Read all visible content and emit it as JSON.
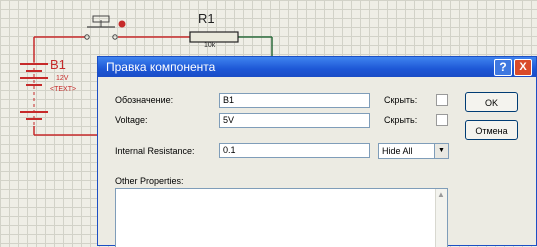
{
  "schematic": {
    "battery_label": "B1",
    "battery_voltage": "12V",
    "battery_text": "<TEXT>",
    "resistor_label": "R1",
    "resistor_value": "10k"
  },
  "dialog": {
    "title": "Правка компонента",
    "help_label": "?",
    "close_label": "X",
    "designator_label": "Обозначение:",
    "designator_value": "B1",
    "hide_label_1": "Скрыть:",
    "voltage_label": "Voltage:",
    "voltage_value": "5V",
    "hide_label_2": "Скрыть:",
    "internal_resistance_label": "Internal Resistance:",
    "internal_resistance_value": "0.1",
    "hide_all_value": "Hide All",
    "other_properties_label": "Other Properties:",
    "ok_button": "OK",
    "cancel_button": "Отмена"
  },
  "colors": {
    "wire_red": "#c62a2a",
    "wire_green": "#2a6a3a",
    "titlebar_blue": "#1d57d6"
  }
}
